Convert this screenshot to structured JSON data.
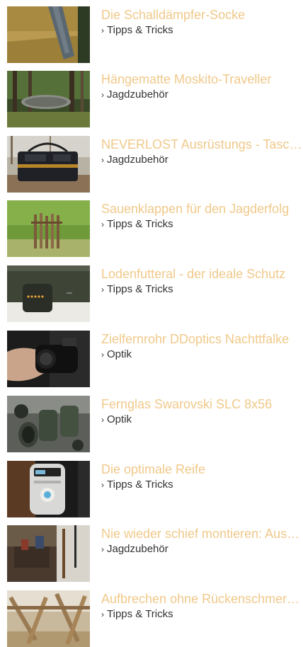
{
  "articles": [
    {
      "title": "Die Schalldämpfer-Socke",
      "category": "Tipps & Tricks",
      "image": "silencer-sock-photo"
    },
    {
      "title": "Hängematte Moskito-Traveller",
      "category": "Jagdzubehör",
      "image": "hammock-forest-photo"
    },
    {
      "title": "NEVERLOST Ausrüstungs - Tasche",
      "category": "Jagdzubehör",
      "image": "gear-bag-photo"
    },
    {
      "title": "Sauenklappen für den Jagderfolg",
      "category": "Tipps & Tricks",
      "image": "wooden-posts-photo"
    },
    {
      "title": "Lodenfutteral - der ideale Schutz",
      "category": "Tipps & Tricks",
      "image": "loden-case-photo"
    },
    {
      "title": "Zielfernrohr DDoptics Nachttfalke",
      "category": "Optik",
      "image": "scope-hand-photo"
    },
    {
      "title": "Fernglas Swarovski SLC 8x56",
      "category": "Optik",
      "image": "binoculars-photo"
    },
    {
      "title": "Die optimale Reife",
      "category": "Tipps & Tricks",
      "image": "aging-device-photo"
    },
    {
      "title": "Nie wieder schief montieren: Ausrichten",
      "category": "Jagdzubehör",
      "image": "workshop-photo"
    },
    {
      "title": "Aufbrechen ohne Rückenschmerzen",
      "category": "Tipps & Tricks",
      "image": "wooden-stand-photo"
    }
  ],
  "category_prefix": "›"
}
